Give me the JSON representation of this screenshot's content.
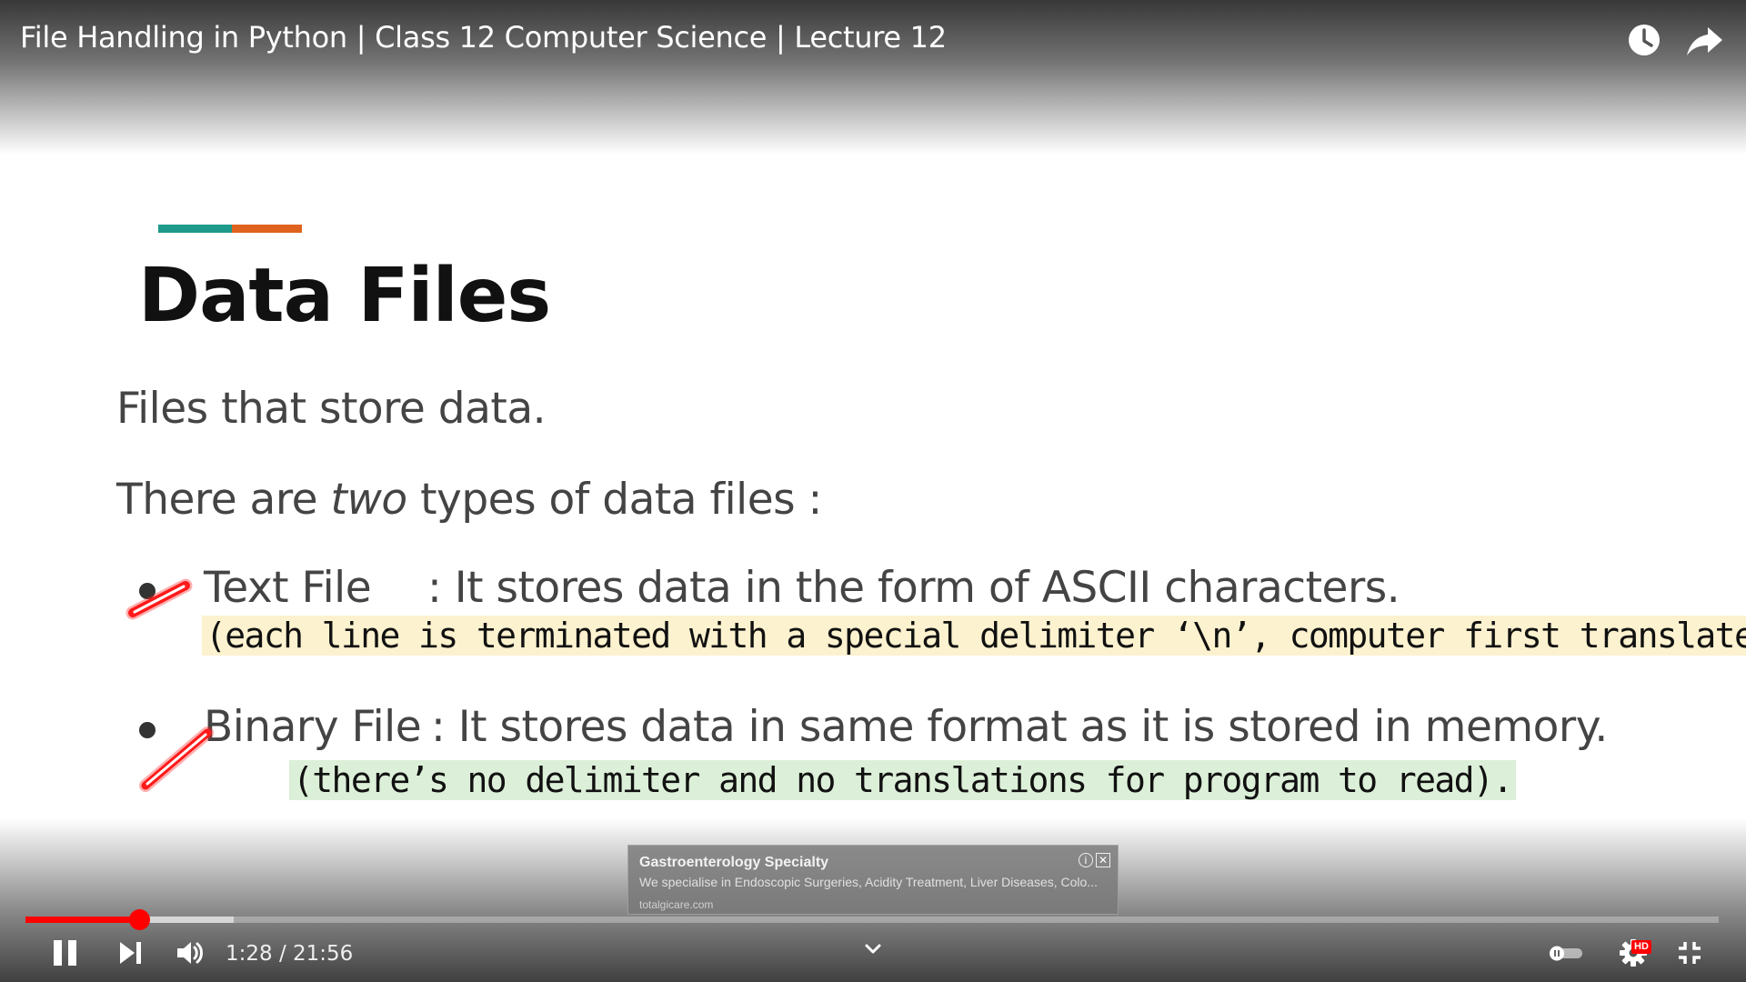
{
  "video": {
    "title": "File Handling in Python | Class 12 Computer Science | Lecture 12",
    "current_time": "1:28",
    "duration": "21:56",
    "time_display": "1:28 / 21:56",
    "progress_fraction": 0.067,
    "buffered_fraction": 0.123,
    "hd_label": "HD"
  },
  "slide": {
    "heading": "Data Files",
    "line1": "Files that store data.",
    "line2_pre": "There are ",
    "line2_em": "two",
    "line2_post": " types of data files :",
    "bullets": [
      {
        "term": "Text File",
        "desc": ": It stores data in the form of ASCII characters.",
        "note": "(each line is terminated with a special delimiter ‘\\n’, computer first translates then reads)."
      },
      {
        "term": "Binary File",
        "desc": ": It stores data in same format as it is stored in memory.",
        "note": "(there’s no delimiter and no translations for program to read)."
      }
    ]
  },
  "ad": {
    "title": "Gastroenterology Specialty",
    "description": "We specialise in Endoscopic Surgeries, Acidity Treatment, Liver Diseases, Colo...",
    "url": "totalgicare.com"
  },
  "icons": {
    "watch_later": "clock-icon",
    "share": "share-arrow-icon",
    "pause": "pause-icon",
    "next": "skip-next-icon",
    "volume": "volume-icon",
    "expand": "chevron-down-icon",
    "autoplay": "autoplay-toggle-icon",
    "settings": "gear-icon",
    "fullscreen_exit": "exit-fullscreen-icon"
  },
  "colors": {
    "accent_teal": "#1e9a8b",
    "accent_orange": "#e0621f",
    "progress_red": "#ff0000",
    "highlight_yellow": "#fdf2cf",
    "highlight_green": "#dcefd8",
    "pen_red": "#ff1a1a"
  }
}
